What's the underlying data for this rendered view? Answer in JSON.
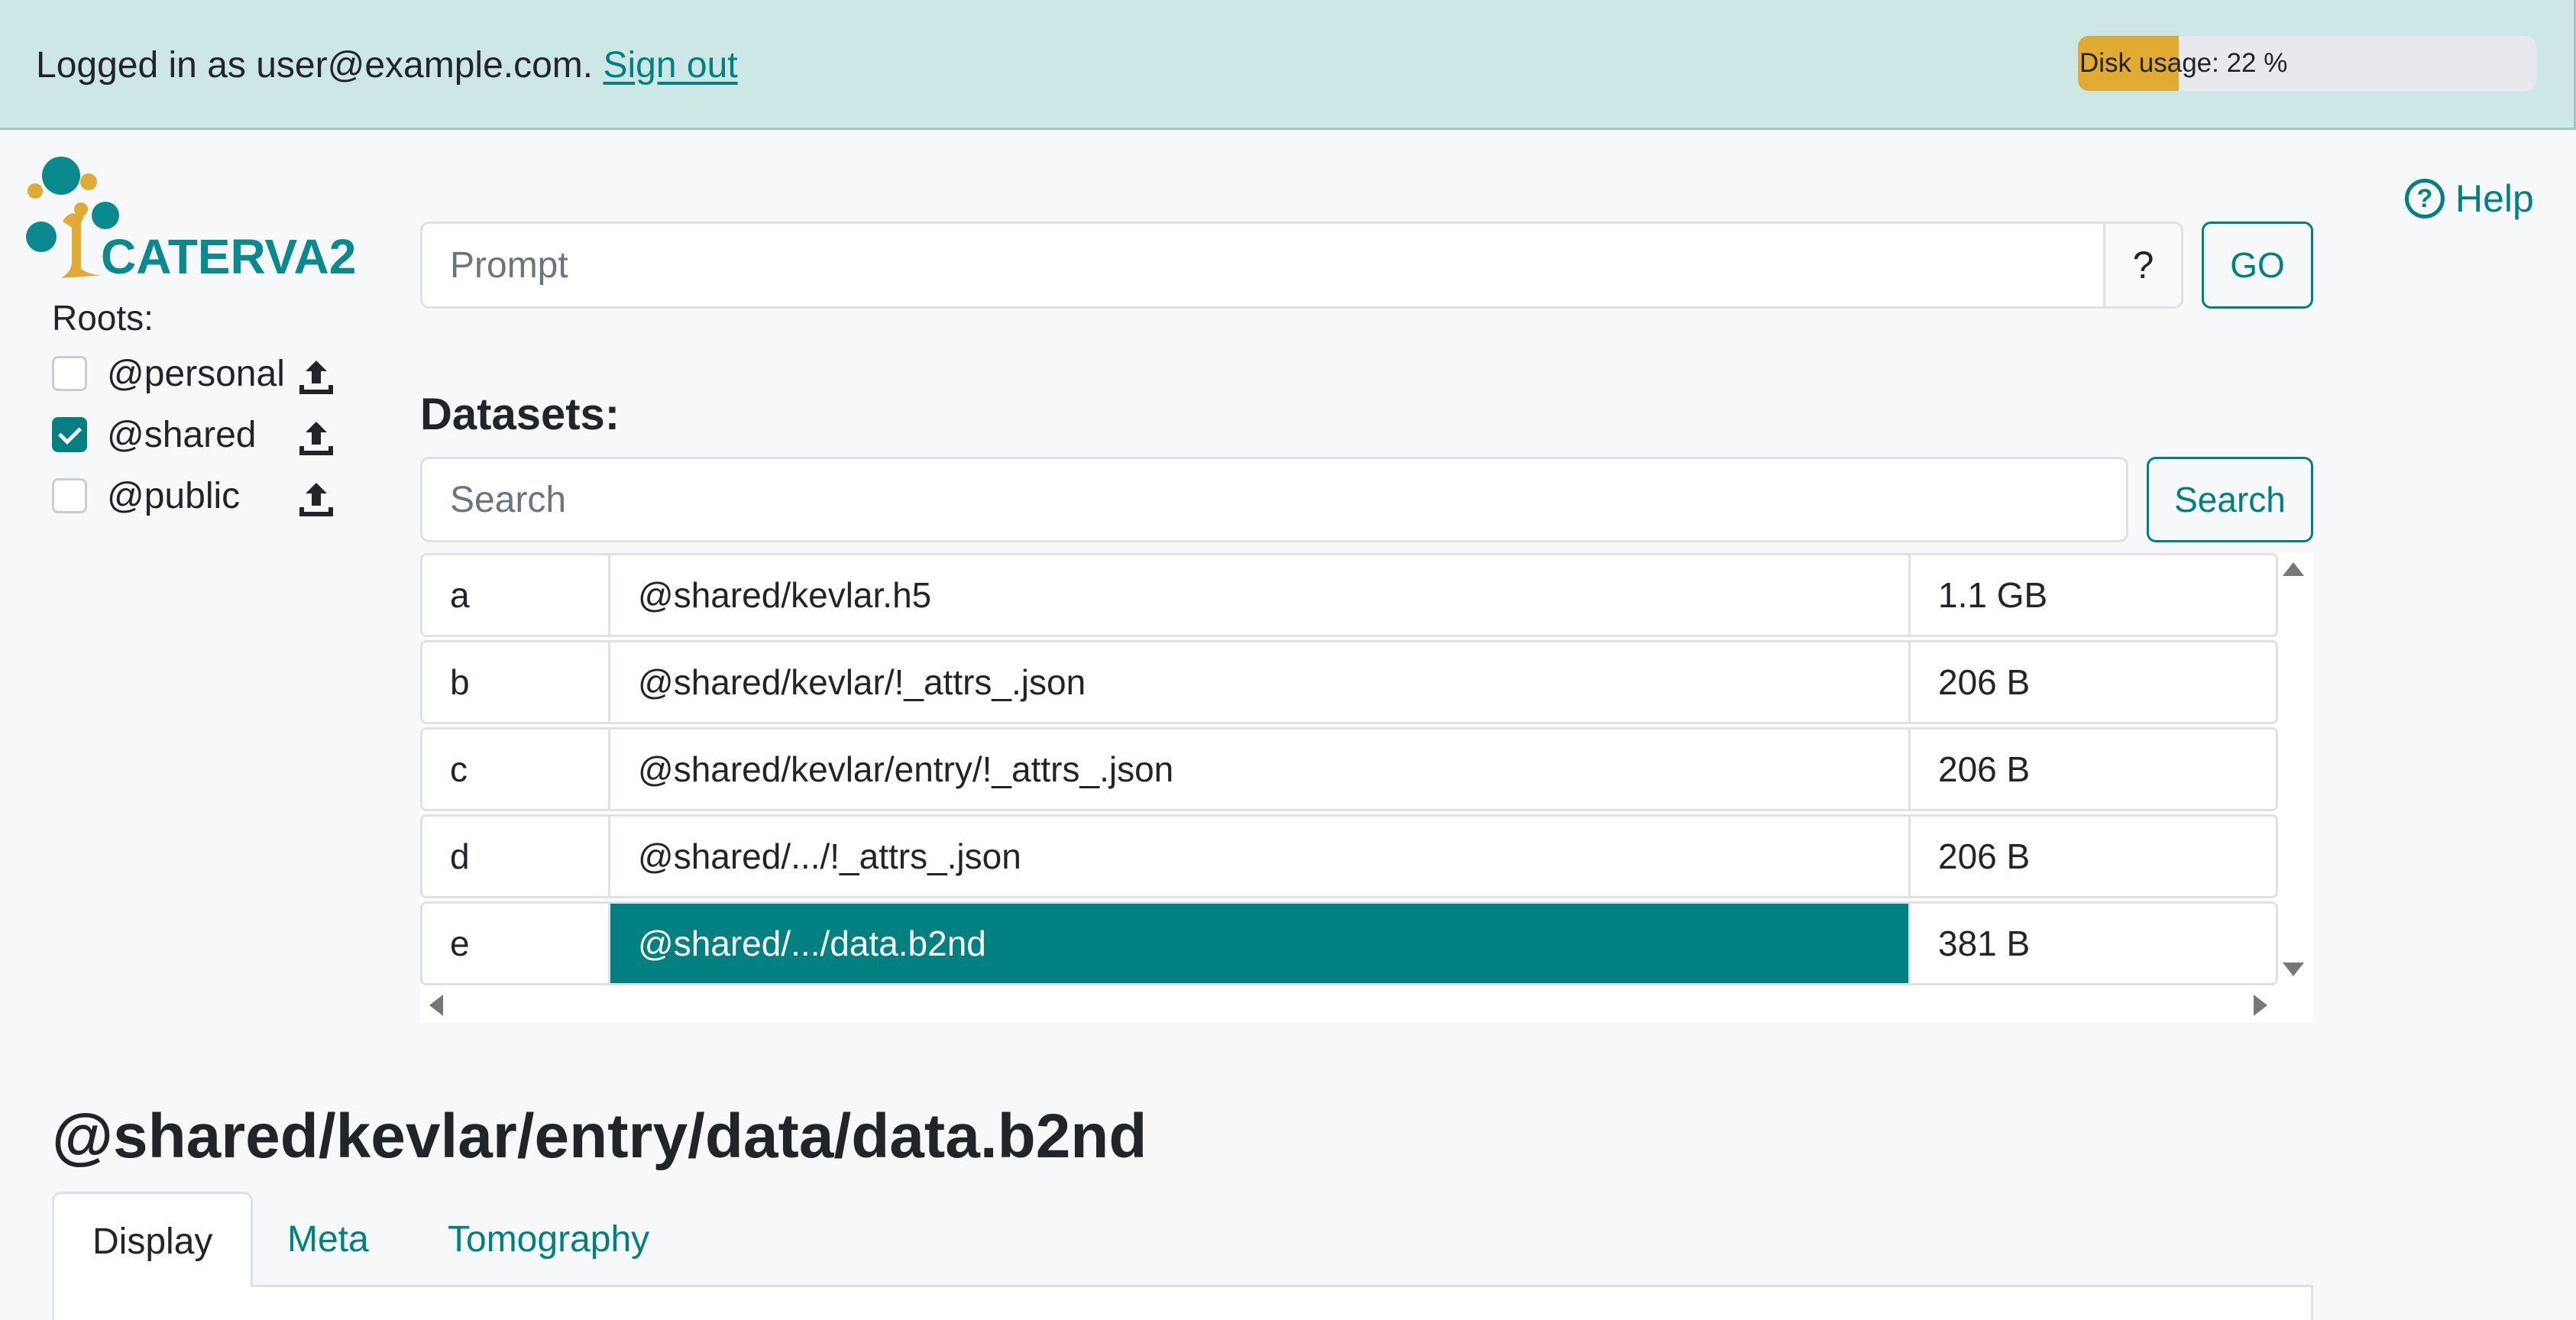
{
  "topbar": {
    "login_prefix": "Logged in as user@example.com.",
    "signout_label": "Sign out",
    "disk_usage_label": "Disk usage: 22 %",
    "disk_usage_percent": 22
  },
  "logo": {
    "text": "CATERVA2"
  },
  "roots": {
    "label": "Roots:",
    "items": [
      {
        "name": "@personal",
        "checked": false,
        "icon": "upload-icon"
      },
      {
        "name": "@shared",
        "checked": true,
        "icon": "upload-icon"
      },
      {
        "name": "@public",
        "checked": false,
        "icon": "upload-icon"
      }
    ]
  },
  "help": {
    "label": "Help",
    "icon": "question-circle-icon"
  },
  "prompt": {
    "placeholder": "Prompt",
    "help_label": "?",
    "go_label": "GO"
  },
  "datasets": {
    "label": "Datasets:",
    "search_placeholder": "Search",
    "search_button": "Search",
    "rows": [
      {
        "key": "a",
        "path": "@shared/kevlar.h5",
        "size": "1.1 GB",
        "selected": false
      },
      {
        "key": "b",
        "path": "@shared/kevlar/!_attrs_.json",
        "size": "206 B",
        "selected": false
      },
      {
        "key": "c",
        "path": "@shared/kevlar/entry/!_attrs_.json",
        "size": "206 B",
        "selected": false
      },
      {
        "key": "d",
        "path": "@shared/.../!_attrs_.json",
        "size": "206 B",
        "selected": false
      },
      {
        "key": "e",
        "path": "@shared/.../data.b2nd",
        "size": "381 B",
        "selected": true
      }
    ]
  },
  "dataset_title": "@shared/kevlar/entry/data/data.b2nd",
  "tabs": [
    {
      "label": "Display",
      "active": true
    },
    {
      "label": "Meta",
      "active": false
    },
    {
      "label": "Tomography",
      "active": false
    }
  ],
  "colors": {
    "accent": "#008080",
    "topbar_bg": "#cde7e6",
    "disk_fill": "#e0aa33",
    "logo_gold": "#e0aa33",
    "logo_teal": "#0a8a8f"
  }
}
